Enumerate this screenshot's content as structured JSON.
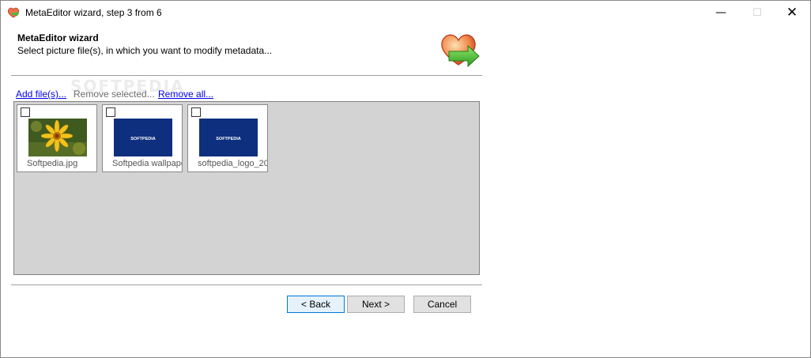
{
  "window": {
    "title": "MetaEditor wizard, step 3 from 6",
    "controls": {
      "minimize": "—",
      "maximize": "☐",
      "close": "✕"
    }
  },
  "header": {
    "title": "MetaEditor wizard",
    "subtitle": "Select picture file(s), in which you want to modify metadata..."
  },
  "watermark": "SOFTPEDIA",
  "actions": {
    "add": "Add file(s)...",
    "remove_selected": "Remove selected...",
    "remove_all": "Remove all..."
  },
  "files": [
    {
      "name": "Softpedia.jpg",
      "thumb": "flower",
      "checked": false
    },
    {
      "name": "Softpedia wallpaper",
      "thumb": "softpedia",
      "checked": false
    },
    {
      "name": "softpedia_logo_20",
      "thumb": "softpedia",
      "checked": false
    }
  ],
  "thumb_label": "SOFTPEDIA",
  "buttons": {
    "back": "< Back",
    "next": "Next >",
    "cancel": "Cancel"
  },
  "colors": {
    "accent": "#0078d7",
    "panel_bg": "#d3d3d3",
    "thumb_blue": "#0d2f7e"
  }
}
